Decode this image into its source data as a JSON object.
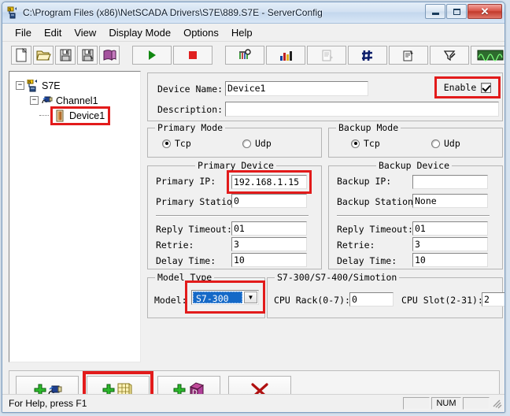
{
  "window": {
    "title": "C:\\Program Files (x86)\\NetSCADA Drivers\\S7E\\889.S7E - ServerConfig",
    "app_icon": "server-config-icon",
    "minimize_label": "Minimize",
    "maximize_label": "Maximize",
    "close_label": "Close"
  },
  "menu": {
    "items": [
      {
        "label": "File"
      },
      {
        "label": "Edit"
      },
      {
        "label": "View"
      },
      {
        "label": "Display Mode"
      },
      {
        "label": "Options"
      },
      {
        "label": "Help"
      }
    ]
  },
  "toolbar": {
    "groups": [
      {
        "buttons": [
          {
            "name": "new-file-button",
            "icon": "new-document-icon"
          },
          {
            "name": "open-file-button",
            "icon": "open-folder-icon"
          },
          {
            "name": "save-button",
            "icon": "floppy-save-icon"
          },
          {
            "name": "save-as-button",
            "icon": "floppy-save-as-icon"
          },
          {
            "name": "about-button",
            "icon": "book-icon"
          }
        ]
      },
      {
        "buttons": [
          {
            "name": "start-button",
            "icon": "play-triangle-icon"
          },
          {
            "name": "stop-button",
            "icon": "stop-square-icon"
          }
        ]
      },
      {
        "buttons": [
          {
            "name": "monitor-tags-button",
            "icon": "wiring-probe-icon"
          },
          {
            "name": "statistics-button",
            "icon": "bar-chart-icon"
          },
          {
            "name": "report-button",
            "icon": "document-export-icon"
          },
          {
            "name": "grid-button",
            "icon": "grid-hash-icon"
          },
          {
            "name": "properties-button",
            "icon": "properties-sheet-icon"
          },
          {
            "name": "diagnostics-button",
            "icon": "funnel-pen-icon"
          },
          {
            "name": "waveform-button",
            "icon": "oscilloscope-wave-icon"
          }
        ]
      }
    ]
  },
  "tree": {
    "nodes": [
      {
        "label": "S7E",
        "icon": "server-node-icon",
        "expanded": true,
        "level": 0,
        "highlighted": false
      },
      {
        "label": "Channel1",
        "icon": "channel-plug-icon",
        "expanded": true,
        "level": 1,
        "highlighted": false
      },
      {
        "label": "Device1",
        "icon": "device-module-icon",
        "expanded": false,
        "level": 2,
        "highlighted": true
      }
    ]
  },
  "device": {
    "name_label": "Device Name:",
    "name_value": "Device1",
    "description_label": "Description:",
    "description_value": "",
    "enable_label": "Enable",
    "enable_checked": true,
    "enable_highlighted": true
  },
  "primary_mode": {
    "title": "Primary Mode",
    "options": [
      {
        "label": "Tcp",
        "selected": true
      },
      {
        "label": "Udp",
        "selected": false
      }
    ]
  },
  "backup_mode": {
    "title": "Backup Mode",
    "options": [
      {
        "label": "Tcp",
        "selected": true
      },
      {
        "label": "Udp",
        "selected": false
      }
    ]
  },
  "primary_device": {
    "title": "Primary Device",
    "ip_label": "Primary IP:",
    "ip_value": "192.168.1.15",
    "ip_highlighted": true,
    "station_label": "Primary Station:",
    "station_value": "0",
    "reply_timeout_label": "Reply Timeout:",
    "reply_timeout_value": "01",
    "retrie_label": "Retrie:",
    "retrie_value": "3",
    "delay_time_label": "Delay Time:",
    "delay_time_value": "10"
  },
  "backup_device": {
    "title": "Backup Device",
    "ip_label": "Backup IP:",
    "ip_value": "",
    "station_label": "Backup Station:",
    "station_value": "None",
    "reply_timeout_label": "Reply Timeout:",
    "reply_timeout_value": "01",
    "retrie_label": "Retrie:",
    "retrie_value": "3",
    "delay_time_label": "Delay Time:",
    "delay_time_value": "10"
  },
  "model_type": {
    "title": "Model Type",
    "model_label": "Model:",
    "model_value": "S7-300",
    "highlighted": true
  },
  "cpu_group": {
    "title": "S7-300/S7-400/Simotion",
    "rack_label": "CPU Rack(0-7):",
    "rack_value": "0",
    "slot_label": "CPU Slot(2-31):",
    "slot_value": "2"
  },
  "bottom_buttons": [
    {
      "name": "add-channel-button",
      "icon": "add-channel-icon",
      "highlighted": false
    },
    {
      "name": "add-device-button",
      "icon": "add-device-icon",
      "highlighted": true
    },
    {
      "name": "add-datablock-button",
      "icon": "add-datablock-icon",
      "highlighted": false
    },
    {
      "name": "delete-button",
      "icon": "red-x-delete-icon",
      "highlighted": false
    }
  ],
  "statusbar": {
    "help_text": "For Help, press F1",
    "panel1": "",
    "num_indicator": "NUM",
    "panel3": ""
  },
  "colors": {
    "highlight_red": "#e21b1b",
    "selection_blue": "#1569c7",
    "window_face": "#f0f0f0",
    "close_red": "#c23a2c"
  }
}
